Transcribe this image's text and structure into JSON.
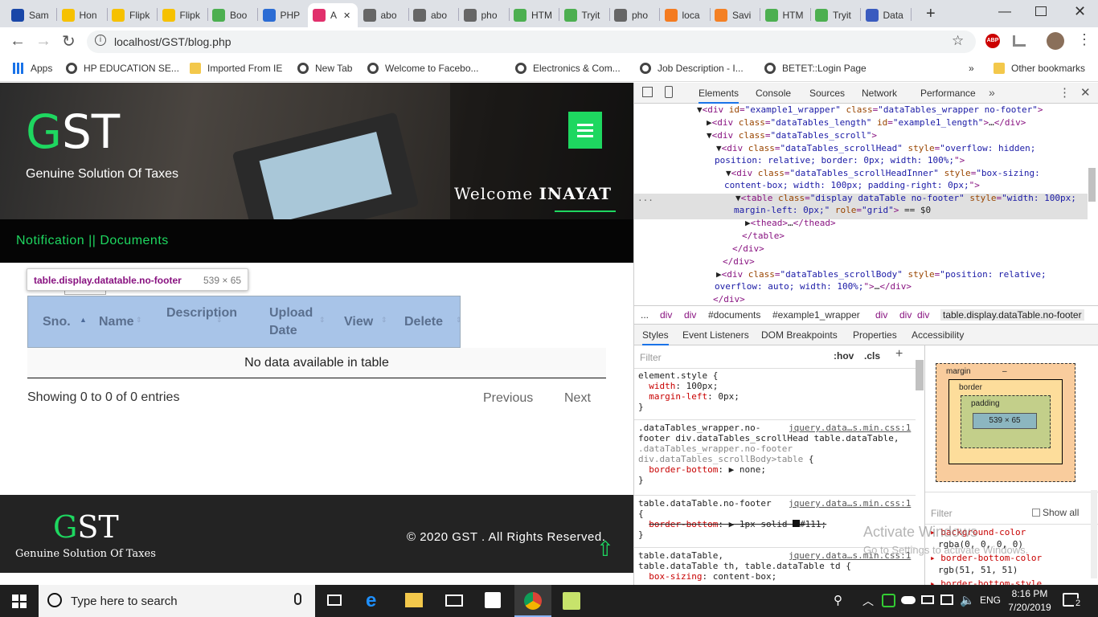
{
  "browser": {
    "tabs": [
      {
        "label": "Sam",
        "icon": "s-logo-icon",
        "color": "#1a47a8"
      },
      {
        "label": "Hon",
        "icon": "flipkart-icon",
        "color": "#f6c100"
      },
      {
        "label": "Flipk",
        "icon": "flipkart-icon",
        "color": "#f6c100"
      },
      {
        "label": "Flipk",
        "icon": "flipkart-icon",
        "color": "#f6c100"
      },
      {
        "label": "Boo",
        "icon": "w3schools-icon",
        "color": "#4caf50"
      },
      {
        "label": "PHP",
        "icon": "w-logo-icon",
        "color": "#2b6cd4"
      },
      {
        "label": "A",
        "icon": "instagram-icon",
        "color": "#e1306c"
      },
      {
        "label": "abo",
        "icon": "globe-icon",
        "color": "#666"
      },
      {
        "label": "abo",
        "icon": "globe-icon",
        "color": "#666"
      },
      {
        "label": "pho",
        "icon": "globe-icon",
        "color": "#666"
      },
      {
        "label": "HTM",
        "icon": "w3schools-icon",
        "color": "#4caf50"
      },
      {
        "label": "Tryit",
        "icon": "w3schools-icon",
        "color": "#4caf50"
      },
      {
        "label": "pho",
        "icon": "globe-icon",
        "color": "#666"
      },
      {
        "label": "loca",
        "icon": "xampp-icon",
        "color": "#f47b20"
      },
      {
        "label": "Savi",
        "icon": "stackoverflow-icon",
        "color": "#f48024"
      },
      {
        "label": "HTM",
        "icon": "w3schools-icon",
        "color": "#4caf50"
      },
      {
        "label": "Tryit",
        "icon": "w3schools-icon",
        "color": "#4caf50"
      },
      {
        "label": "Data",
        "icon": "datatables-icon",
        "color": "#3a5bbf"
      }
    ],
    "url": "localhost/GST/blog.php",
    "bookmarks": [
      {
        "label": "Apps",
        "icon": "apps-grid-icon"
      },
      {
        "label": "HP EDUCATION SE...",
        "icon": "globe-icon"
      },
      {
        "label": "Imported From IE",
        "icon": "folder-icon"
      },
      {
        "label": "New Tab",
        "icon": "globe-icon"
      },
      {
        "label": "Welcome to Facebo...",
        "icon": "globe-icon"
      },
      {
        "label": "Electronics & Com...",
        "icon": "globe-icon"
      },
      {
        "label": "Job Description - I...",
        "icon": "globe-icon"
      },
      {
        "label": "BETET::Login Page",
        "icon": "globe-icon"
      }
    ],
    "more_bookmarks": "»",
    "other_bookmarks": "Other bookmarks"
  },
  "site": {
    "logo_g": "G",
    "logo_st": "ST",
    "tagline": "Genuine Solution Of Taxes",
    "welcome_prefix": "Welcome",
    "welcome_user": "INAYAT",
    "nav_text": "Notification || Documents",
    "accent": "#1ed760",
    "tooltip_name": "table.display.datatable.no-footer",
    "tooltip_size": "539 × 65",
    "table_headers": [
      "Sno.",
      "Name",
      "Description",
      "Upload Date",
      "View",
      "Delete"
    ],
    "empty_message": "No data available in table",
    "info": "Showing 0 to 0 of 0 entries",
    "prev": "Previous",
    "next": "Next",
    "footer_logo_g": "G",
    "footer_logo_st": "ST",
    "footer_tagline": "Genuine Solution Of Taxes",
    "copyright": "© 2020 GST . All Rights Reserved."
  },
  "devtools": {
    "tabs": [
      "Elements",
      "Console",
      "Sources",
      "Network",
      "Performance"
    ],
    "more_tabs": "»",
    "breadcrumb": [
      "...",
      "div",
      "div",
      "#documents",
      "#example1_wrapper",
      "div",
      "div",
      "div",
      "table.display.dataTable.no-footer"
    ],
    "subtabs": [
      "Styles",
      "Event Listeners",
      "DOM Breakpoints",
      "Properties",
      "Accessibility"
    ],
    "filter_placeholder": "Filter",
    "hov": ":hov",
    "cls": ".cls",
    "boxmodel": {
      "margin": "margin",
      "border": "border",
      "padding": "padding",
      "content": "539 × 65",
      "dash": "–"
    },
    "computed_filter": "Filter",
    "show_all": "Show all",
    "computed": [
      {
        "prop": "background-color",
        "value": "rgba(0, 0, 0, 0)"
      },
      {
        "prop": "border-bottom-color",
        "value": "rgb(51, 51, 51)"
      },
      {
        "prop": "border-bottom-style",
        "value": ""
      }
    ],
    "watermark_title": "Activate Windows",
    "watermark_sub": "Go to Settings to activate Windows."
  },
  "taskbar": {
    "search_placeholder": "Type here to search",
    "lang": "ENG",
    "time": "8:16 PM",
    "date": "7/20/2019",
    "notifications": "2"
  }
}
